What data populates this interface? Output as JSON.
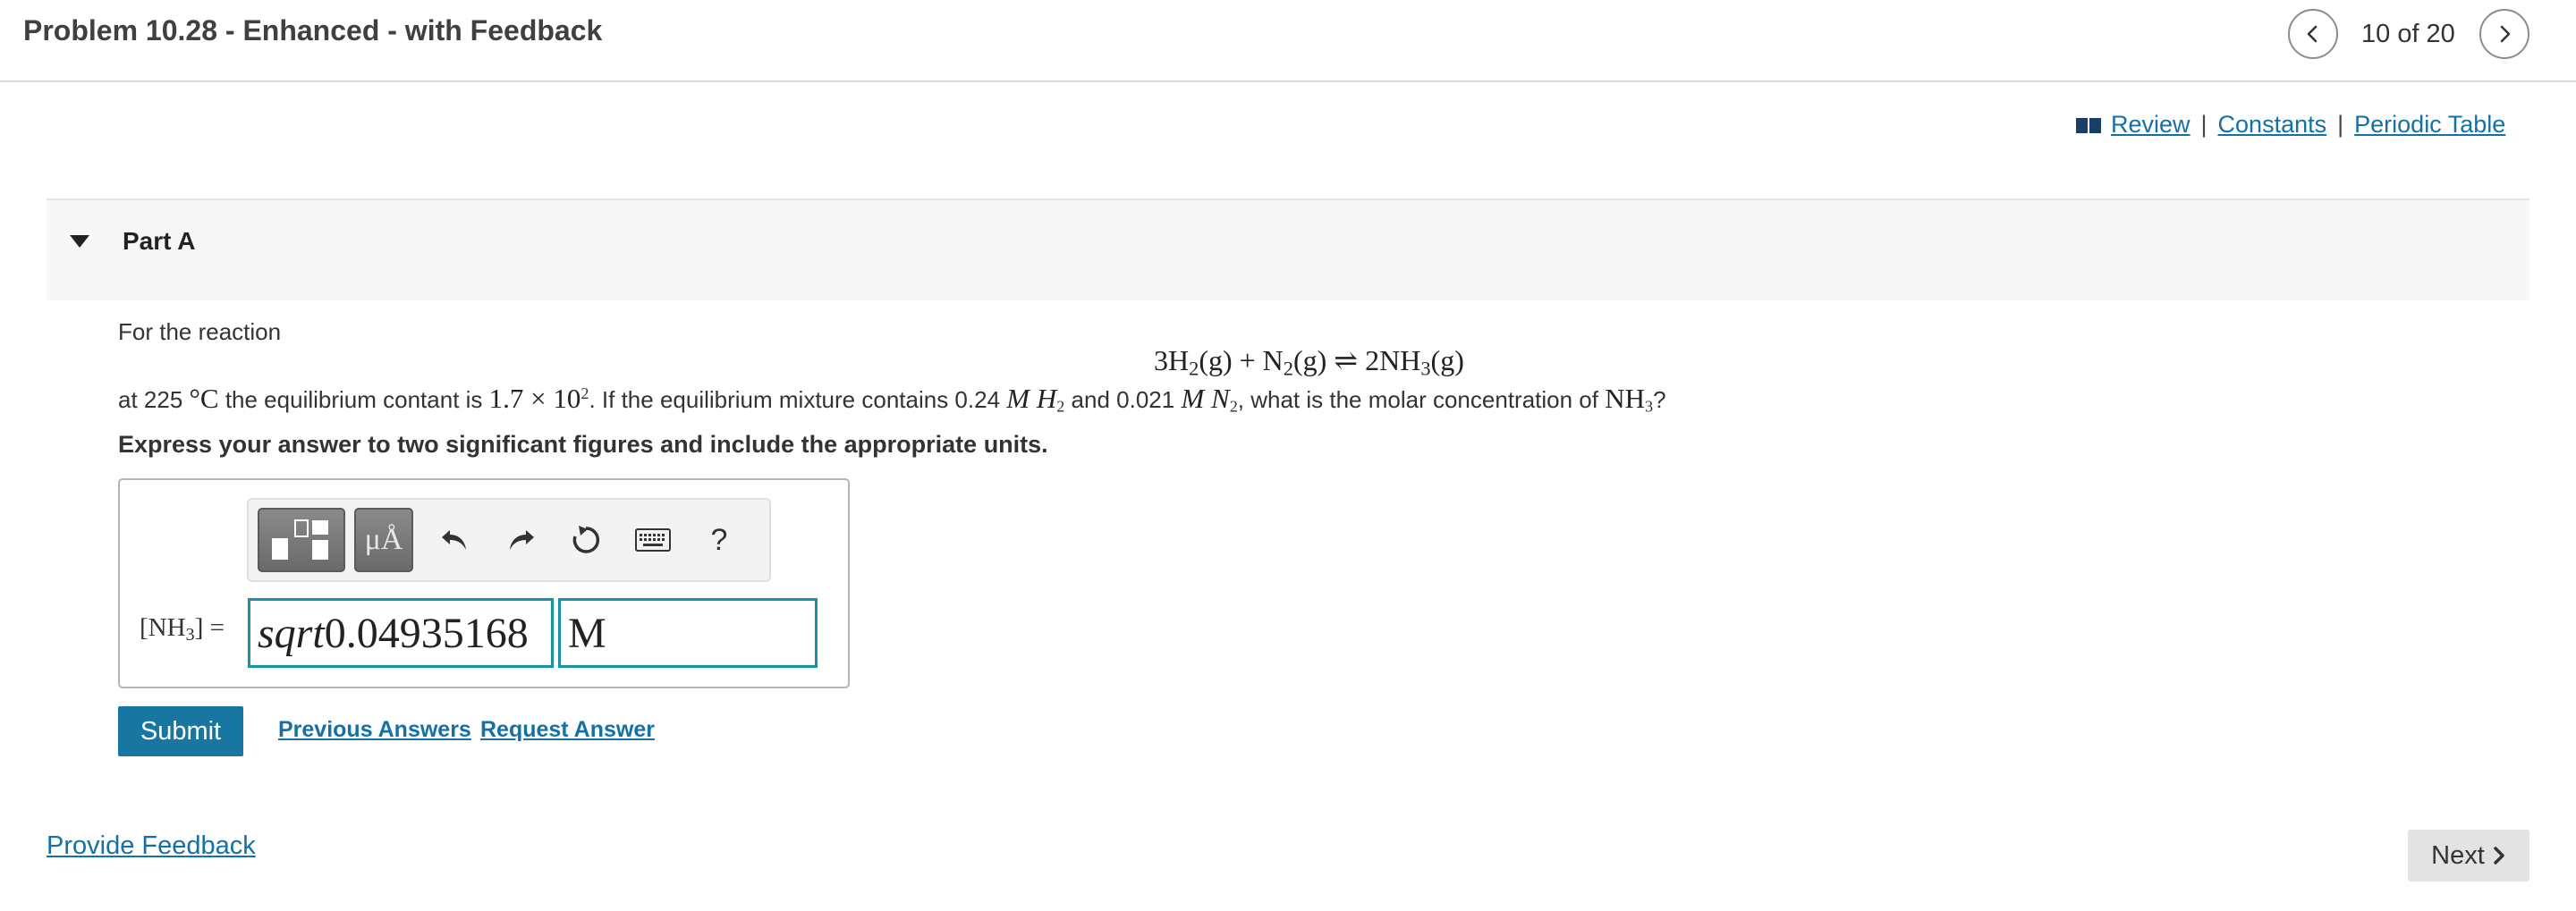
{
  "header": {
    "title": "Problem 10.28 - Enhanced - with Feedback",
    "pager": "10 of 20",
    "prev_icon": "chevron-left-icon",
    "next_icon": "chevron-right-icon"
  },
  "resources": {
    "review": "Review",
    "sep": "|",
    "constants": "Constants",
    "periodic_table": "Periodic Table"
  },
  "part": {
    "title": "Part A"
  },
  "question": {
    "intro": "For the  reaction",
    "eq_left": "3H",
    "eq_h_sub": "2",
    "eq_g1": "(g) + N",
    "eq_n_sub": "2",
    "eq_g2": "(g) ⇌ 2NH",
    "eq_nh_sub": "3",
    "eq_g3": "(g)",
    "body_1": "at 225 ",
    "body_deg": "°C",
    "body_2": " the equilibrium contant  is ",
    "body_k": "1.7 × 10",
    "body_k_exp": "2",
    "body_3": ". If the equilibrium mixture contains 0.24 ",
    "body_mh": "M H",
    "body_mh_sub": "2",
    "body_4": " and 0.021 ",
    "body_mn": "M N",
    "body_mn_sub": "2",
    "body_5": ", what is the molar concentration of ",
    "body_nh": "NH",
    "body_nh_sub": "3",
    "body_6": "?",
    "instruction": "Express your answer to two significant figures and include the appropriate units."
  },
  "toolbar": {
    "symbols_label": "μÅ",
    "help_label": "?"
  },
  "answer": {
    "label_open": "[NH",
    "label_sub": "3",
    "label_close": "] =",
    "value": "sqrt0.04935168",
    "value_prefix": "sqrt",
    "value_number": "0.04935168",
    "units": "M"
  },
  "actions": {
    "submit": "Submit",
    "previous_answers": "Previous Answers",
    "request_answer": "Request Answer"
  },
  "footer": {
    "provide_feedback": "Provide Feedback",
    "next": "Next"
  },
  "colors": {
    "link": "#1371a8",
    "submit_bg": "#1777a0",
    "field_border": "#1b8fa3"
  }
}
